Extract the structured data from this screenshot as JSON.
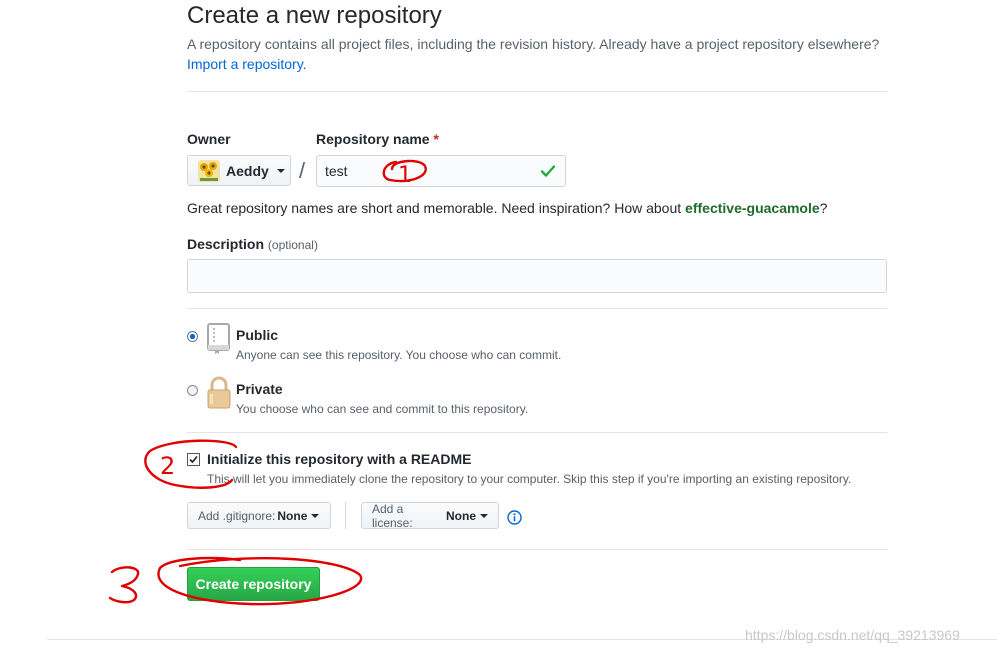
{
  "header": {
    "title": "Create a new repository",
    "subtitle": "A repository contains all project files, including the revision history. Already have a project repository elsewhere?",
    "import_link": "Import a repository."
  },
  "form": {
    "owner": {
      "label": "Owner",
      "value": "Aeddy"
    },
    "separator": "/",
    "repo_name": {
      "label": "Repository name",
      "required_mark": "*",
      "value": "test",
      "valid": true
    },
    "hint": {
      "text": "Great repository names are short and memorable. Need inspiration? How about ",
      "suggestion": "effective-guacamole",
      "suffix": "?"
    },
    "description": {
      "label": "Description",
      "optional": "(optional)",
      "value": "",
      "placeholder": ""
    },
    "visibility": {
      "selected": "public",
      "options": [
        {
          "id": "public",
          "title": "Public",
          "note": "Anyone can see this repository. You choose who can commit."
        },
        {
          "id": "private",
          "title": "Private",
          "note": "You choose who can see and commit to this repository."
        }
      ]
    },
    "readme": {
      "checked": true,
      "label": "Initialize this repository with a README",
      "note": "This will let you immediately clone the repository to your computer. Skip this step if you're importing an existing repository."
    },
    "gitignore": {
      "prefix": "Add .gitignore:",
      "value": "None"
    },
    "license": {
      "prefix": "Add a license:",
      "value": "None"
    },
    "submit_label": "Create repository"
  },
  "annotations": {
    "mark_1": "1",
    "mark_2": "2",
    "mark_3": "3"
  },
  "watermark": "https://blog.csdn.net/qq_39213969",
  "colors": {
    "accent_link": "#0366d6",
    "success_green": "#28a745",
    "required_red": "#cb2431",
    "annotation_red": "#e00000"
  },
  "icons": {
    "check": "check-icon",
    "public_repo": "repo-icon",
    "private_repo": "lock-icon",
    "info": "info-icon",
    "dropdown": "caret-down-icon"
  }
}
